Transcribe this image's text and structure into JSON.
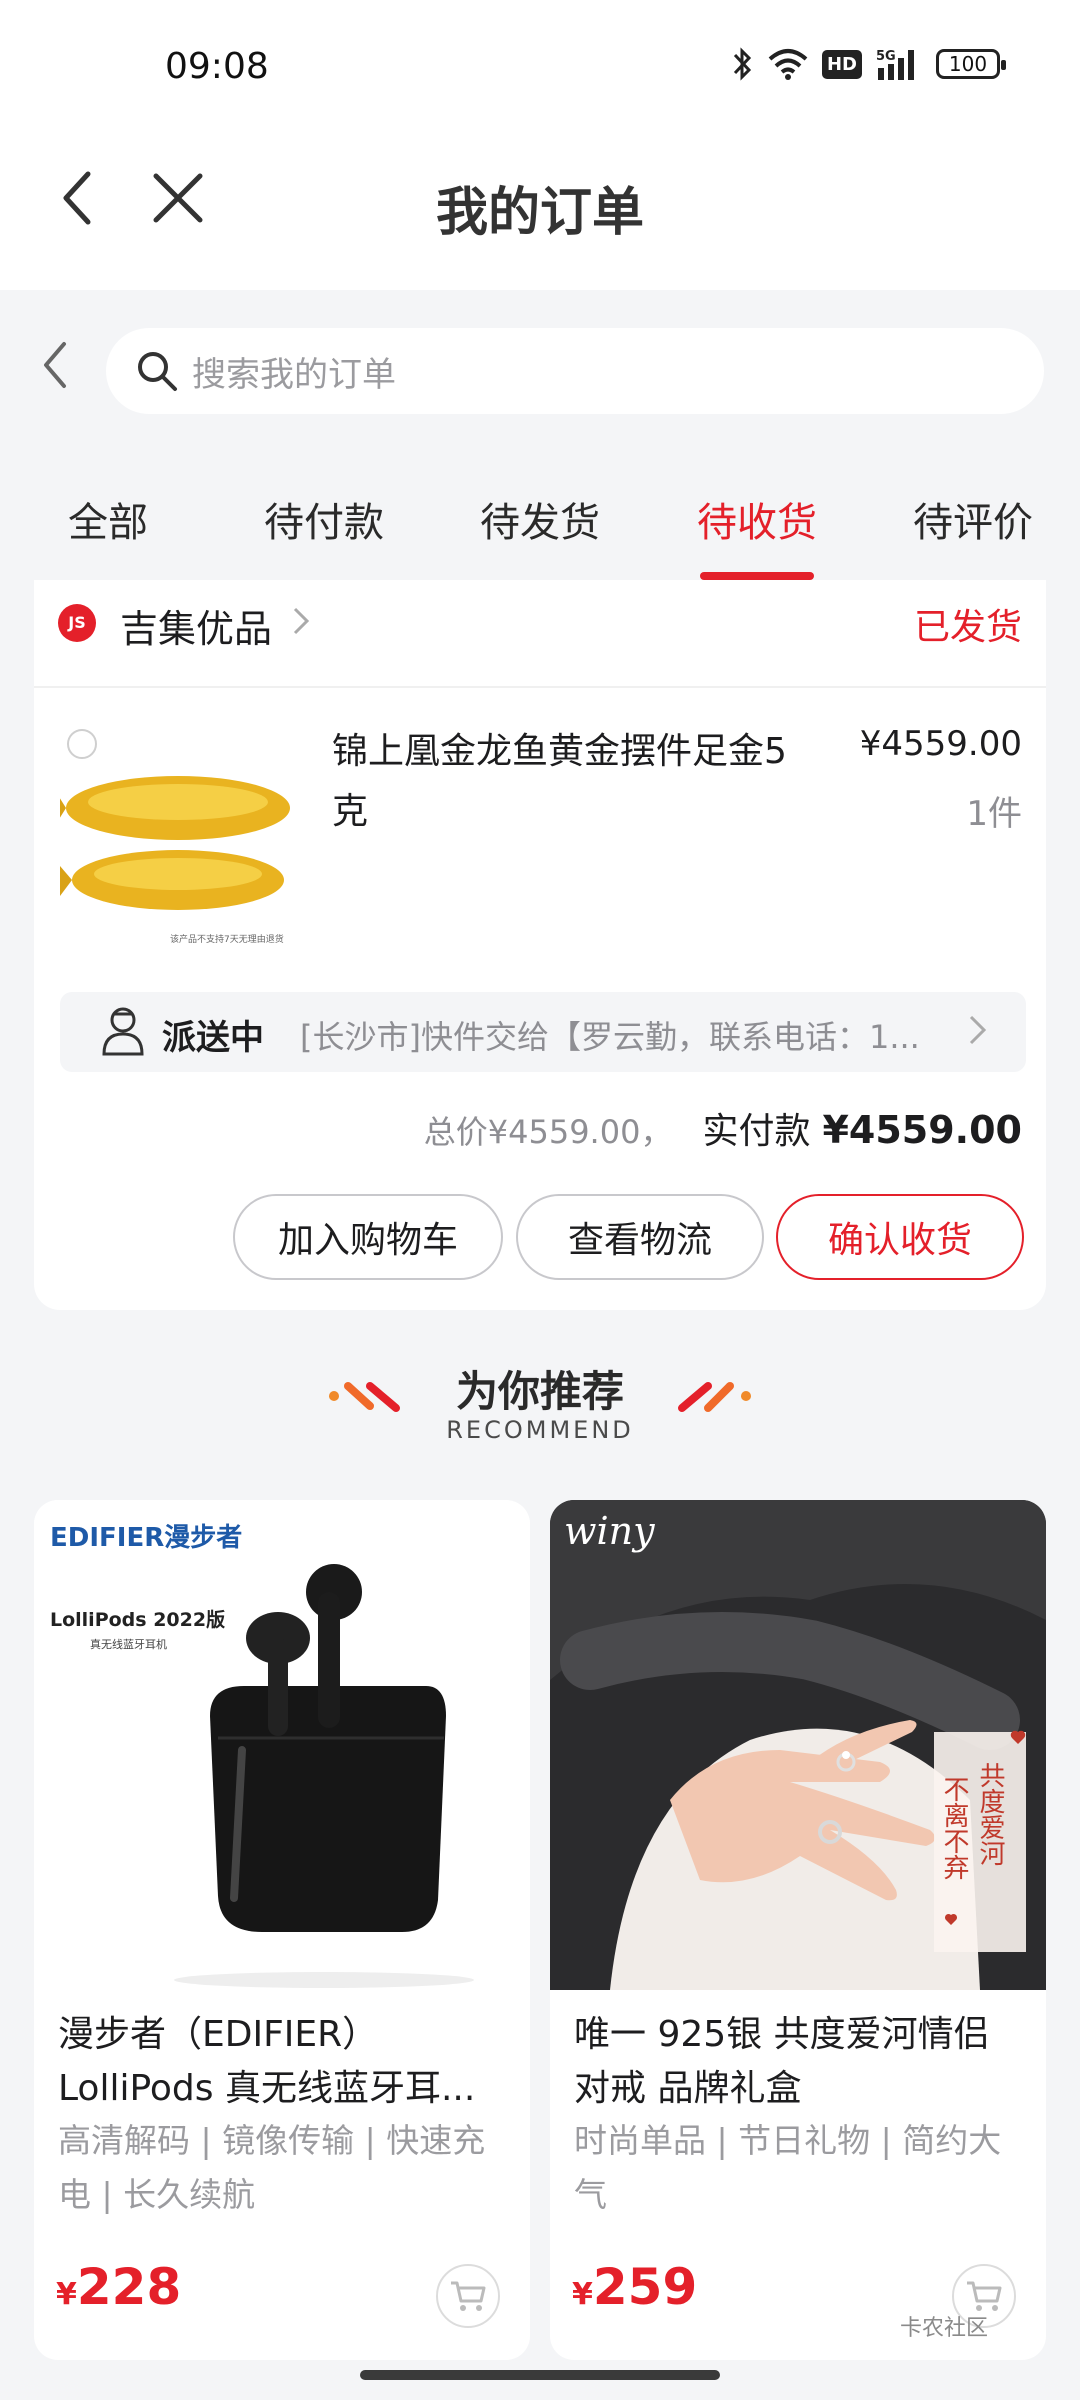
{
  "status_bar": {
    "time": "09:08",
    "hd": "HD",
    "network": "5G",
    "battery": "100"
  },
  "header": {
    "title": "我的订单"
  },
  "search": {
    "placeholder": "搜索我的订单"
  },
  "tabs": [
    {
      "label": "全部",
      "active": false
    },
    {
      "label": "待付款",
      "active": false
    },
    {
      "label": "待发货",
      "active": false
    },
    {
      "label": "待收货",
      "active": true
    },
    {
      "label": "待评价",
      "active": false
    }
  ],
  "order": {
    "shop_logo_text": "JS",
    "shop_name": "吉集优品",
    "status": "已发货",
    "product": {
      "name": "锦上凰金龙鱼黄金摆件足金5克",
      "price": "¥4559.00",
      "quantity": "1件",
      "image_caption": "该产品不支持7天无理由退货"
    },
    "delivery": {
      "status": "派送中",
      "info": "[长沙市]快件交给【罗云勤，联系电话：1..."
    },
    "total": "总价¥4559.00，",
    "paid_label": "实付款",
    "paid_value": "¥4559.00",
    "buttons": {
      "add_cart": "加入购物车",
      "view_logistics": "查看物流",
      "confirm_receipt": "确认收货"
    }
  },
  "recommend": {
    "title": "为你推荐",
    "subtitle": "RECOMMEND",
    "items": [
      {
        "brand_text": "EDIFIER漫步者",
        "model_text": "LolliPods 2022版",
        "model_sub": "真无线蓝牙耳机",
        "name_line1": "漫步者（EDIFIER）",
        "name_line2": "LolliPods 真无线蓝牙耳...",
        "tags": "高清解码 | 镜像传输 | 快速充电 | 长久续航",
        "currency": "¥",
        "price": "228"
      },
      {
        "brand_text": "winy",
        "overlay_text_1": "不离不弃",
        "overlay_text_2": "共度爱河",
        "name_line1": "唯一 925银 共度爱河情侣",
        "name_line2": "对戒 品牌礼盒",
        "tags": "时尚单品 | 节日礼物 | 简约大气",
        "currency": "¥",
        "price": "259"
      }
    ]
  },
  "watermark": "卡农社区",
  "colors": {
    "accent": "#e4202a",
    "background": "#f4f5f7",
    "muted": "#8e8e93"
  }
}
